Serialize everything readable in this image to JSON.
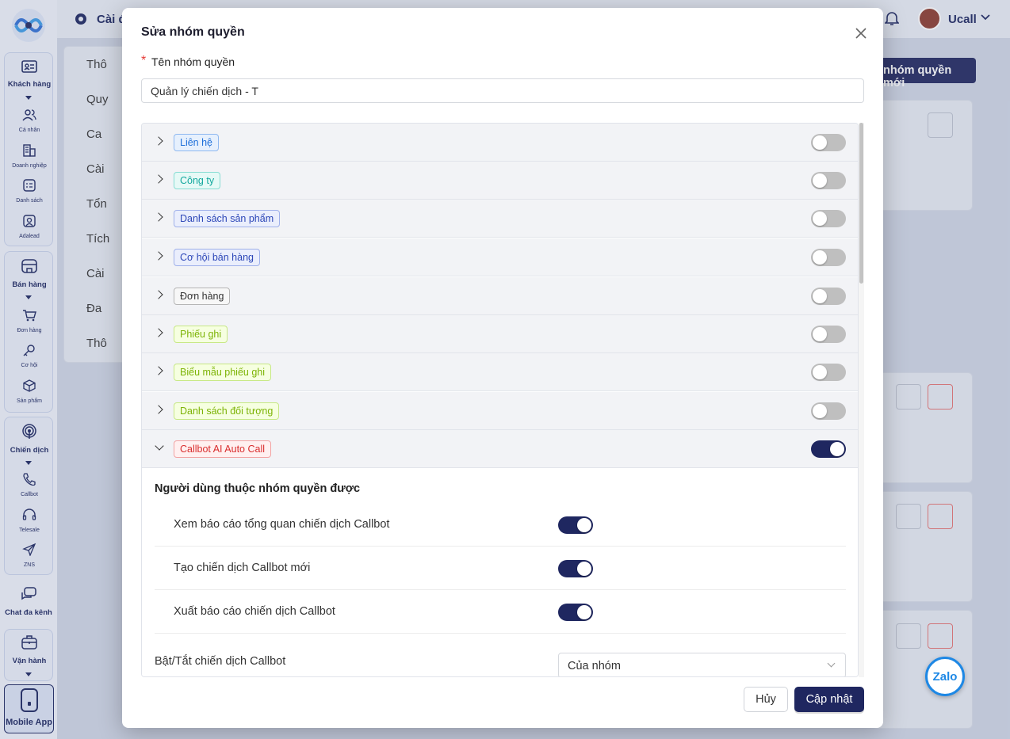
{
  "topbar": {
    "settings_label": "Cài đ",
    "user_name": "Ucall",
    "new_group_button": "nhóm quyền mới"
  },
  "bg_menu": [
    "Thô",
    "Quy",
    "Ca",
    "Cài",
    "Tổn",
    "Tích",
    "Cài",
    "Đa",
    "Thô"
  ],
  "sidebar": {
    "khach_hang": "Khách hàng",
    "ca_nhan": "Cá nhân",
    "doanh_nghiep": "Doanh nghiệp",
    "danh_sach": "Danh sách",
    "adalead": "Adalead",
    "ban_hang": "Bán hàng",
    "don_hang": "Đơn hàng",
    "co_hoi": "Cơ hội",
    "san_pham": "Sản phẩm",
    "chien_dich": "Chiến dịch",
    "callbot": "Callbot",
    "telesale": "Telesale",
    "zns": "ZNS",
    "chat": "Chat đa kênh",
    "van_hanh": "Vận hành",
    "mobile_app": "Mobile App"
  },
  "modal": {
    "title": "Sửa nhóm quyền",
    "name_label": "Tên nhóm quyền",
    "name_value": "Quản lý chiến dịch - T",
    "cancel": "Hủy",
    "submit": "Cập nhật"
  },
  "modules": [
    {
      "label": "Liên hệ",
      "enabled": false,
      "color": "#1e6fd9",
      "bg": "#e6f0fd",
      "border": "#8fb8f0"
    },
    {
      "label": "Công ty",
      "enabled": false,
      "color": "#13a89e",
      "bg": "#e6f9f6",
      "border": "#86ddd3"
    },
    {
      "label": "Danh sách sản phẩm",
      "enabled": false,
      "color": "#2d47b8",
      "bg": "#eaeefc",
      "border": "#9fb0ea"
    },
    {
      "label": "Cơ hội bán hàng",
      "enabled": false,
      "color": "#2d47b8",
      "bg": "#eaeefc",
      "border": "#9fb0ea"
    },
    {
      "label": "Đơn hàng",
      "enabled": false,
      "color": "#333333",
      "bg": "#f7f7f7",
      "border": "#b5b5b5"
    },
    {
      "label": "Phiếu ghi",
      "enabled": false,
      "color": "#7cb305",
      "bg": "#f6ffe0",
      "border": "#c7e885"
    },
    {
      "label": "Biểu mẫu phiếu ghi",
      "enabled": false,
      "color": "#7cb305",
      "bg": "#f6ffe0",
      "border": "#c7e885"
    },
    {
      "label": "Danh sách đối tượng",
      "enabled": false,
      "color": "#7cb305",
      "bg": "#f6ffe0",
      "border": "#c7e885"
    },
    {
      "label": "Callbot AI Auto Call",
      "enabled": true,
      "color": "#d92d2d",
      "bg": "#fff0f0",
      "border": "#f2a3a3"
    }
  ],
  "callbot_section": {
    "heading": "Người dùng thuộc nhóm quyền được",
    "permissions": [
      {
        "label": "Xem báo cáo tổng quan chiến dịch Callbot",
        "enabled": true
      },
      {
        "label": "Tạo chiến dịch Callbot mới",
        "enabled": true
      },
      {
        "label": "Xuất báo cáo chiến dịch Callbot",
        "enabled": true
      }
    ],
    "toggle_campaign_label": "Bật/Tắt chiến dịch Callbot",
    "toggle_campaign_value": "Của nhóm"
  },
  "zalo_label": "Zalo"
}
